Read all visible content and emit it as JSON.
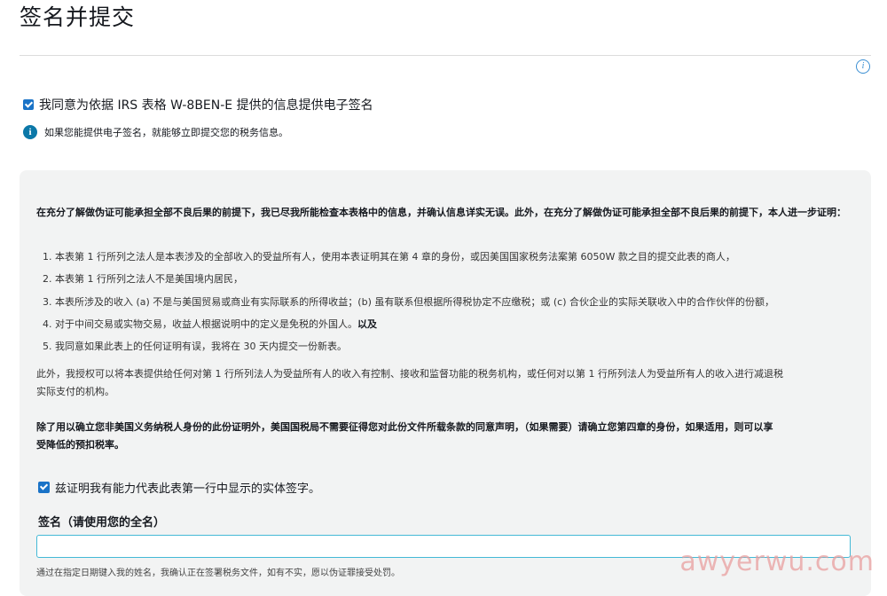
{
  "page": {
    "title": "签名并提交"
  },
  "consent": {
    "checked": true,
    "label": "我同意为依据 IRS 表格 W-8BEN-E 提供的信息提供电子签名"
  },
  "hint": {
    "icon": "info-icon",
    "text": "如果您能提供电子签名，就能够立即提交您的税务信息。"
  },
  "certification": {
    "intro": "在充分了解做伪证可能承担全部不良后果的前提下，我已尽我所能检查本表格中的信息，并确认信息详实无误。此外，在充分了解做伪证可能承担全部不良后果的前提下，本人进一步证明：",
    "items": [
      "1. 本表第 1 行所列之法人是本表涉及的全部收入的受益所有人，使用本表证明其在第 4 章的身份，或因美国国家税务法案第 6050W 款之目的提交此表的商人，",
      "2. 本表第 1 行所列之法人不是美国境内居民，",
      "3. 本表所涉及的收入 (a) 不是与美国贸易或商业有实际联系的所得收益；(b) 虽有联系但根据所得税协定不应缴税；或 (c) 合伙企业的实际关联收入中的合作伙伴的份额，",
      "4. 对于中间交易或实物交易，收益人根据说明中的定义是免税的外国人。",
      "5. 我同意如果此表上的任何证明有误，我将在 30 天内提交一份新表。"
    ],
    "item4_suffix": "以及",
    "authorization_line1": "此外，我授权可以将本表提供给任何对第 1 行所列法人为受益所有人的收入有控制、接收和监督功能的税务机构，或任何对以第 1 行所列法人为受益所有人的收入进行减退税",
    "authorization_line2": "实际支付的机构。",
    "irs_note_line1": "除了用以确立您非美国义务纳税人身份的此份证明外，美国国税局不需要征得您对此份文件所载条款的同意声明，（如果需要）请确立您第四章的身份，如果适用，则可以享",
    "irs_note_line2": "受降低的预扣税率。",
    "capacity_checked": true,
    "capacity_label": "兹证明我有能力代表此表第一行中显示的实体签字。"
  },
  "signature": {
    "label": "签名（请使用您的全名）",
    "value": "",
    "placeholder": "",
    "note": "通过在指定日期键入我的姓名，我确认正在签署税务文件，如有不实，愿以伪证罪接受处罚。"
  },
  "watermark": "awyerwu.com"
}
